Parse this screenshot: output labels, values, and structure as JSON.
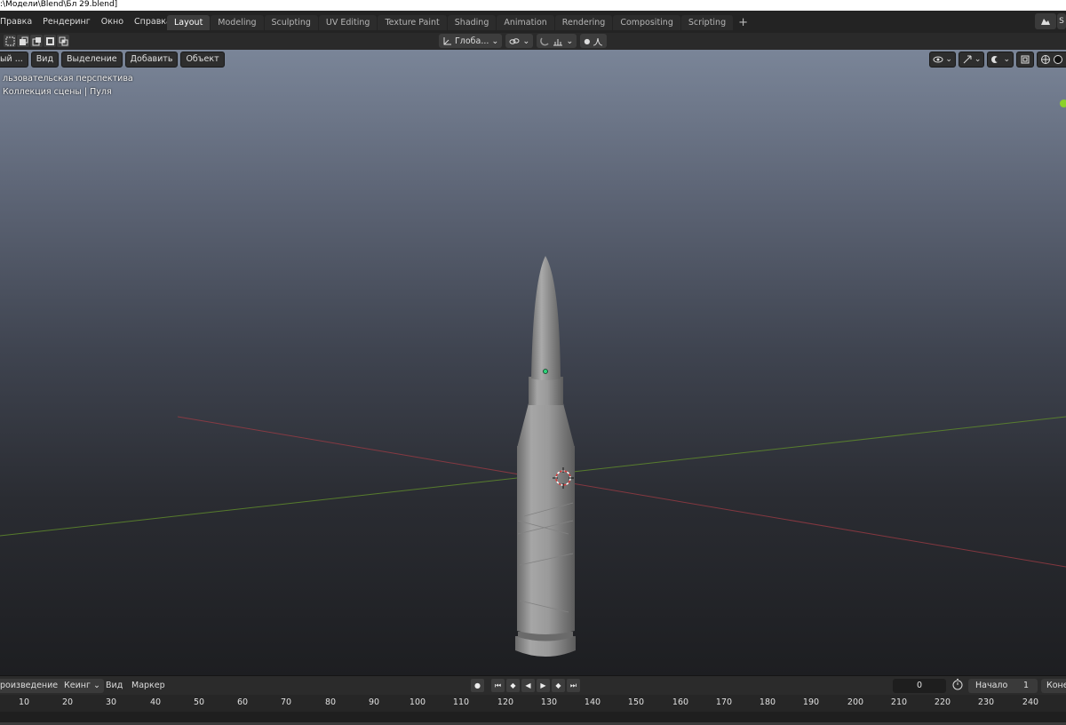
{
  "window": {
    "title": ":\\Модели\\Blend\\Бл 29.blend]"
  },
  "menu": [
    "Правка",
    "Рендеринг",
    "Окно",
    "Справка"
  ],
  "workspace_tabs": [
    {
      "label": "Layout",
      "active": true
    },
    {
      "label": "Modeling"
    },
    {
      "label": "Sculpting"
    },
    {
      "label": "UV Editing"
    },
    {
      "label": "Texture Paint"
    },
    {
      "label": "Shading"
    },
    {
      "label": "Animation"
    },
    {
      "label": "Rendering"
    },
    {
      "label": "Compositing"
    },
    {
      "label": "Scripting"
    }
  ],
  "add_workspace_label": "+",
  "top_right": {
    "scene_letter": "S"
  },
  "tool_header": {
    "orientation_label": "Глоба...",
    "icons": [
      "select-box-icon",
      "select-extend-icon",
      "select-subtract-icon",
      "select-invert-icon",
      "select-intersect-icon"
    ]
  },
  "viewport": {
    "mode_label": "ый ...",
    "menu": {
      "view": "Вид",
      "select": "Выделение",
      "add": "Добавить",
      "object": "Объект"
    },
    "perspective_label": "льзовательская перспектива",
    "collection_label": "Коллекция сцены | Пуля",
    "colors": {
      "x_axis": "#9b3b44",
      "y_axis": "#5f8a2c",
      "origin": "#2ed27a",
      "gizmo_y": "#8cd12b"
    }
  },
  "timeline": {
    "playback_label": "роизведение",
    "keying_label": "Кеинг",
    "view_label": "Вид",
    "marker_label": "Маркер",
    "current_frame": "0",
    "start_label": "Начало",
    "start_frame": "1",
    "end_label": "Коне"
  },
  "ruler": {
    "ticks": [
      "10",
      "20",
      "30",
      "40",
      "50",
      "60",
      "70",
      "80",
      "90",
      "100",
      "110",
      "120",
      "130",
      "140",
      "150",
      "160",
      "170",
      "180",
      "190",
      "200",
      "210",
      "220",
      "230",
      "240"
    ]
  }
}
